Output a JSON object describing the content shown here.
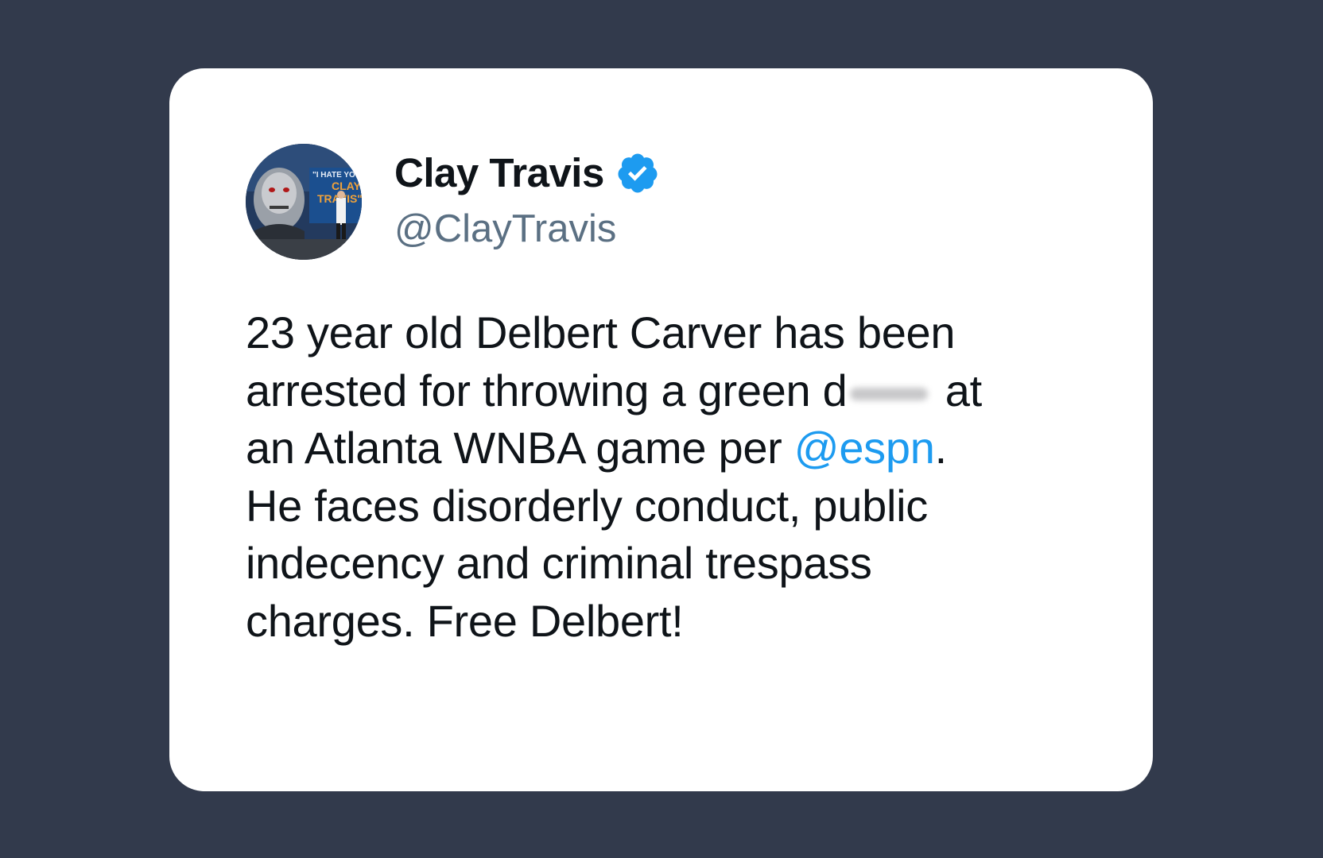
{
  "author": {
    "display_name": "Clay Travis",
    "handle": "@ClayTravis",
    "verified": true,
    "avatar_sign_lines": [
      "\"I HATE YOU",
      "CLAY",
      "TRAVIS\""
    ]
  },
  "tweet": {
    "line1": "23 year old Delbert Carver has been",
    "line2_a": "arrested for throwing a green d",
    "line2_b": "at",
    "line3_a": "an Atlanta WNBA game per ",
    "mention": "@espn",
    "line3_b": ".",
    "line4": "He faces disorderly conduct, public",
    "line5": "indecency and criminal trespass",
    "line6": "charges. Free Delbert!"
  },
  "colors": {
    "background": "#323a4c",
    "card": "#ffffff",
    "text": "#0f1419",
    "handle": "#5b7083",
    "mention": "#1d9bf0",
    "verified": "#1d9bf0"
  },
  "icons": {
    "verified": "verified-badge-icon",
    "avatar": "profile-photo"
  }
}
